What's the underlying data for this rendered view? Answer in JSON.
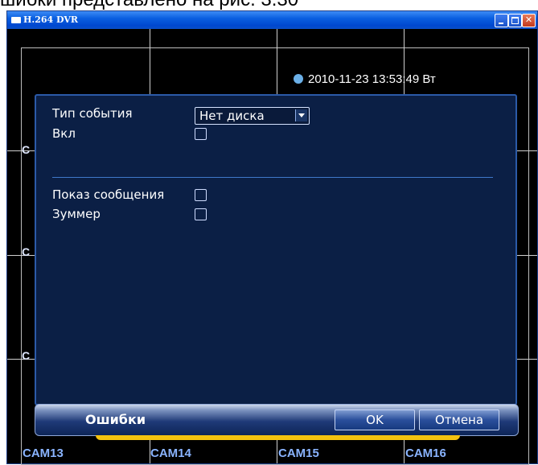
{
  "caption": "шибки представлено на рис. 3.30",
  "window": {
    "title": "H.264 DVR",
    "buttons": {
      "minimize": "",
      "maximize": "",
      "close": "✕"
    }
  },
  "monitor": {
    "clock": "2010-11-23 13:53:49 Вт",
    "side_labels": [
      "C",
      "C",
      "C"
    ],
    "cameras": [
      "CAM13",
      "CAM14",
      "CAM15",
      "CAM16"
    ]
  },
  "dialog": {
    "event_type_label": "Тип события",
    "event_type_value": "Нет диска",
    "enable_label": "Вкл",
    "show_message_label": "Показ сообщения",
    "buzzer_label": "Зуммер"
  },
  "footer": {
    "title": "Ошибки",
    "ok_label": "OK",
    "cancel_label": "Отмена"
  },
  "colors": {
    "dialog_bg": "#0b1f45",
    "accent": "#2b5aa8",
    "yellow": "#f3c20f"
  }
}
